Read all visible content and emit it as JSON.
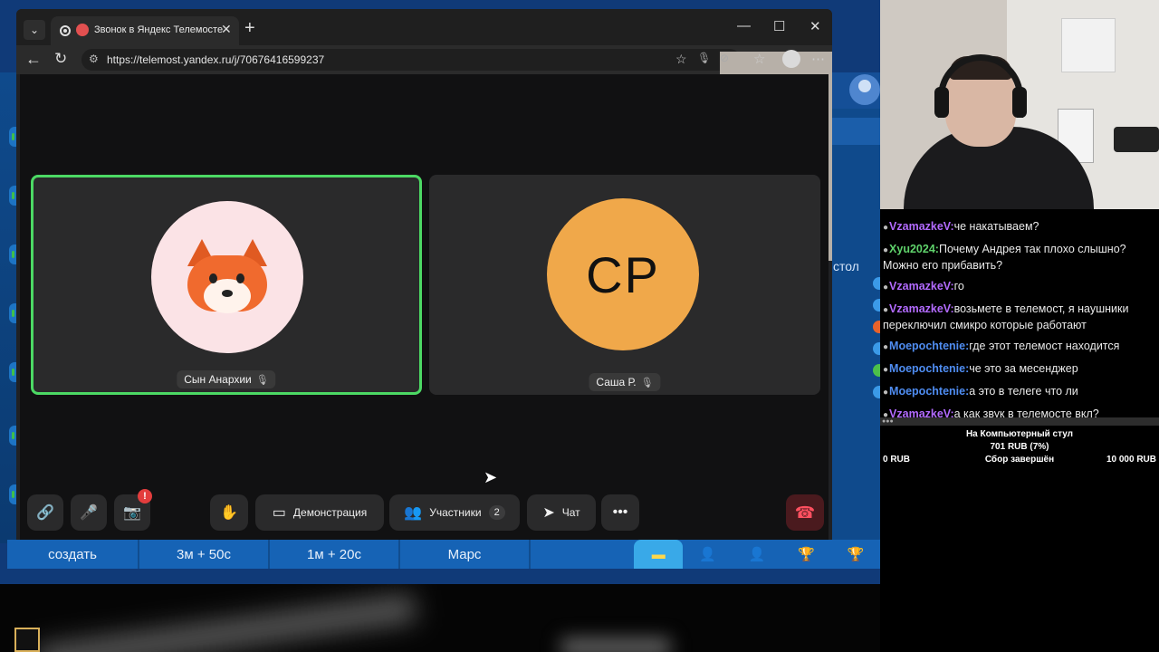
{
  "browser": {
    "tab_title": "Звонок в Яндекс Телемосте",
    "url": "https://telemost.yandex.ru/j/70676416599237",
    "extension_label": "Я"
  },
  "call": {
    "participants": [
      {
        "name": "Сын Анархии",
        "active": true,
        "avatar": "fox-emoji"
      },
      {
        "name": "Саша Р.",
        "active": false,
        "initials": "СР",
        "avatar_color": "#f0a84a"
      }
    ],
    "toolbar": {
      "screen_share_label": "Демонстрация",
      "participants_label": "Участники",
      "participants_count": "2",
      "chat_label": "Чат",
      "camera_badge": "!"
    }
  },
  "background": {
    "bottom_items": [
      "создать",
      "3м + 50с",
      "1м + 20с",
      "Марс"
    ],
    "side_text": "стол"
  },
  "stream": {
    "chat": [
      {
        "user": "VzamazkeV:",
        "text": "че накатываем?",
        "color": "purple"
      },
      {
        "user": "Xyu2024:",
        "text": "Почему Андрея так плохо слышно? Можно его прибавить?",
        "color": "green"
      },
      {
        "user": "VzamazkeV:",
        "text": "го",
        "color": "purple"
      },
      {
        "user": "VzamazkeV:",
        "text": "возьмете в телемост, я наушники переключил смикро которые работают",
        "color": "purple"
      },
      {
        "user": "Moepochtenie:",
        "text": "где этот телемост находится",
        "color": "blue"
      },
      {
        "user": "Moepochtenie:",
        "text": "че это за месенджер",
        "color": "blue"
      },
      {
        "user": "Moepochtenie:",
        "text": "а это в телеге что ли",
        "color": "blue"
      },
      {
        "user": "VzamazkeV:",
        "text": "а как звук в телемосте вкл?",
        "color": "purple"
      }
    ],
    "donation": {
      "goal": "На Компьютерный стул",
      "amount": "701 RUB (7%)",
      "min": "0 RUB",
      "status": "Сбор завершён",
      "max": "10 000 RUB",
      "progress": 0.07
    }
  },
  "colors": {
    "active_speaker": "#4cd964",
    "game_blue": "#1663b5",
    "hangup": "#ff5060"
  }
}
